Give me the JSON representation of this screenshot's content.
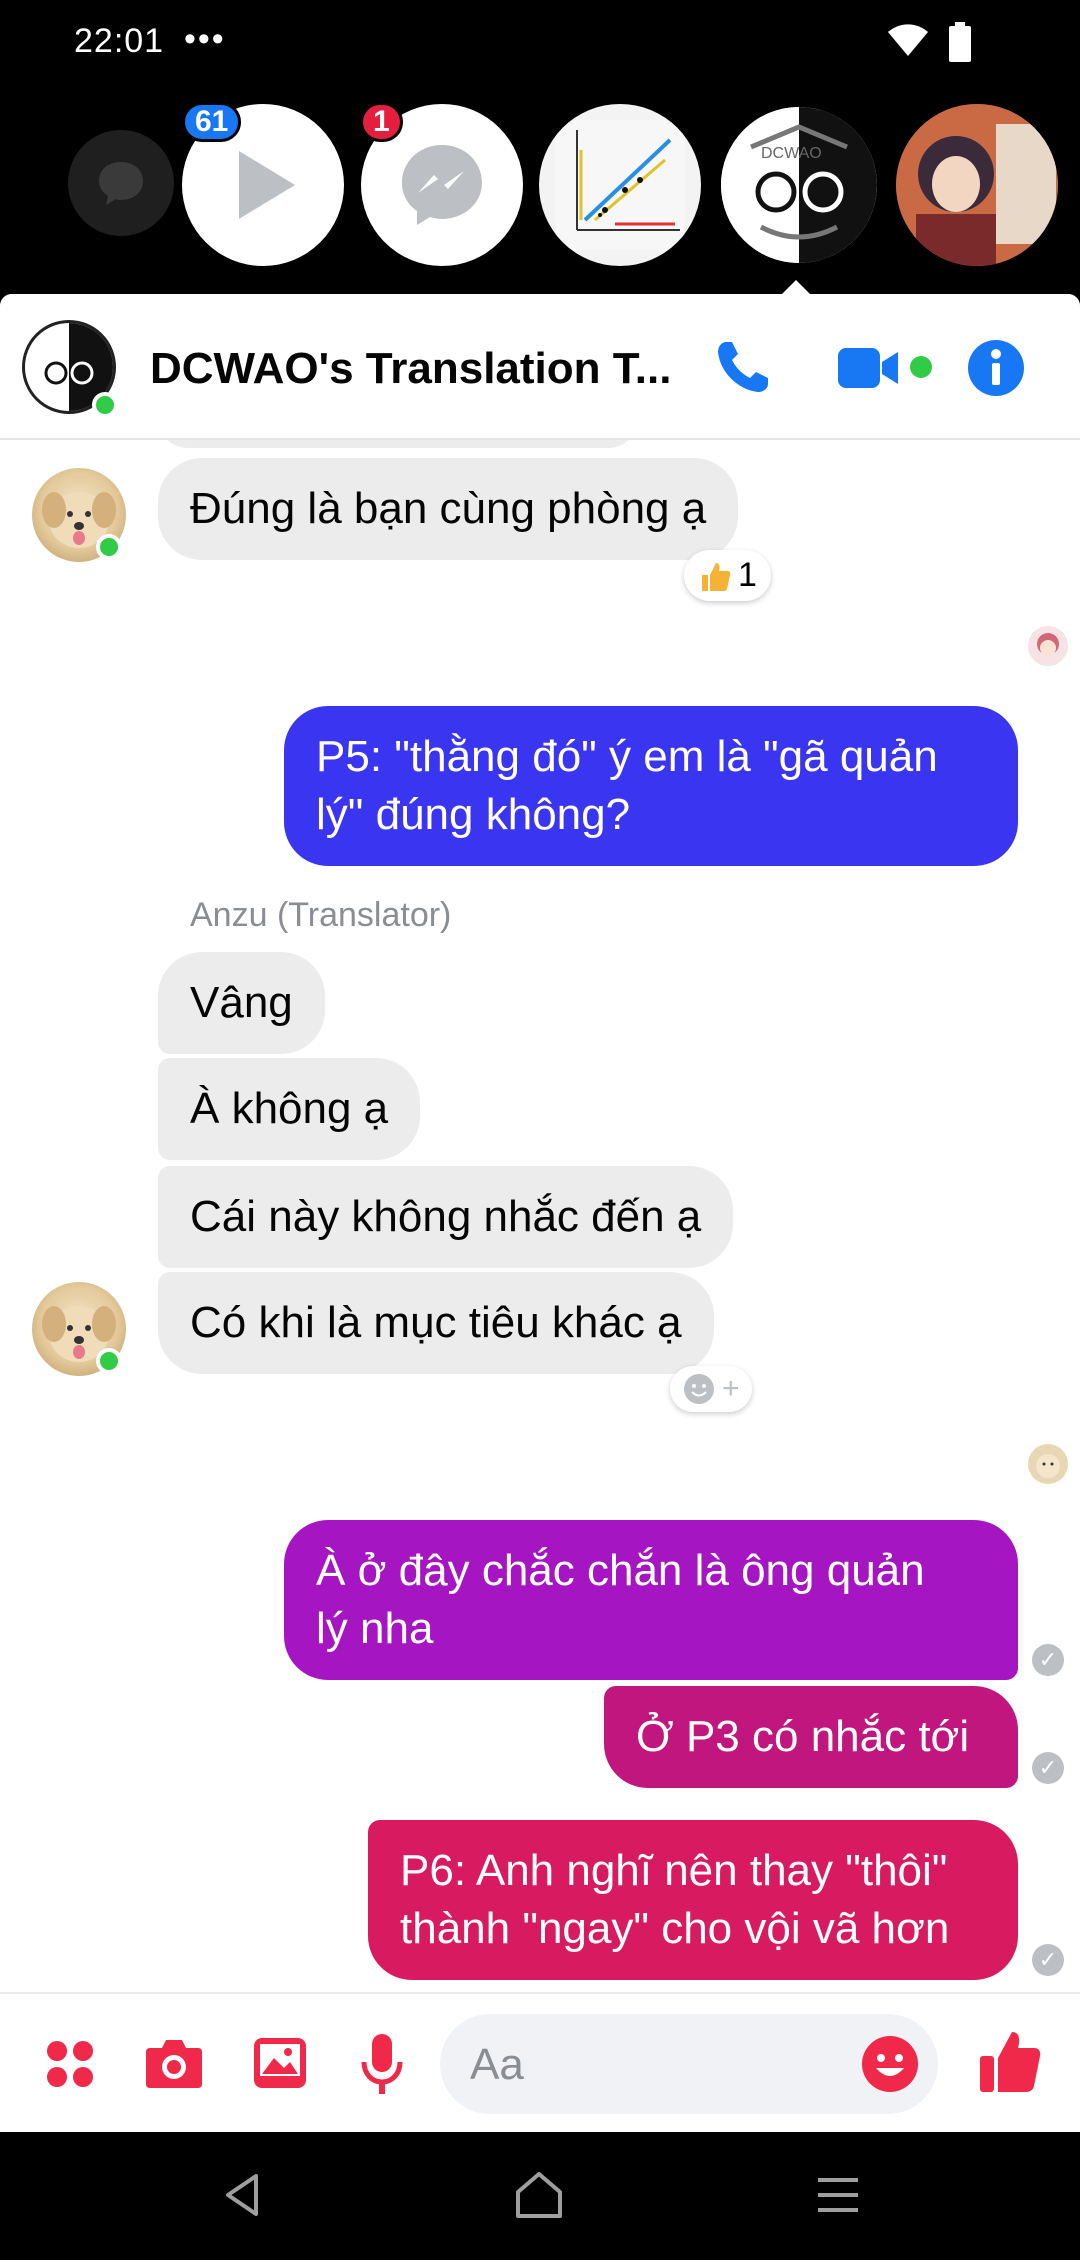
{
  "status_bar": {
    "time": "22:01",
    "dots": "•••"
  },
  "chat_heads": {
    "badges": [
      "61",
      "1"
    ],
    "items": [
      "chat-bubble-icon",
      "video-play-icon",
      "messenger-icon",
      "graph-thumbnail",
      "dcwao-group",
      "anime-avatar"
    ],
    "head4_text": "DCWAO"
  },
  "header": {
    "title": "DCWAO's Translation T...",
    "icons": [
      "phone-icon",
      "video-call-icon",
      "info-icon"
    ]
  },
  "messages": {
    "m1": "Đúng là bạn cùng phòng ạ",
    "m1_reaction_count": "1",
    "m2": "P5: \"thằng đó\" ý em là \"gã quản lý\" đúng không?",
    "m2_l1": "P5: \"thằng đó\" ý em là \"gã quản",
    "m2_l2": "lý\" đúng không?",
    "sender": "Anzu (Translator)",
    "m3": "Vâng",
    "m4": "À không ạ",
    "m5": "Cái này không nhắc đến ạ",
    "m6": "Có khi là mục tiêu khác ạ",
    "react_add": "+",
    "m7_l1": "À ở đây chắc chắn là ông quản",
    "m7_l2": "lý nha",
    "m8": "Ở P3 có nhắc tới",
    "m9_l1": "P6: Anh nghĩ nên thay \"thôi\"",
    "m9_l2": "thành \"ngay\" cho vội vã hơn",
    "seen_check": "✓"
  },
  "composer": {
    "placeholder": "Aa"
  },
  "colors": {
    "blue_bubble": "#3a35f0",
    "purple_bubble": "#a615c2",
    "magenta_bubble": "#c0167e",
    "pink_bubble": "#d81b60",
    "accent": "#1877f2",
    "composer_accent": "#f02849"
  }
}
